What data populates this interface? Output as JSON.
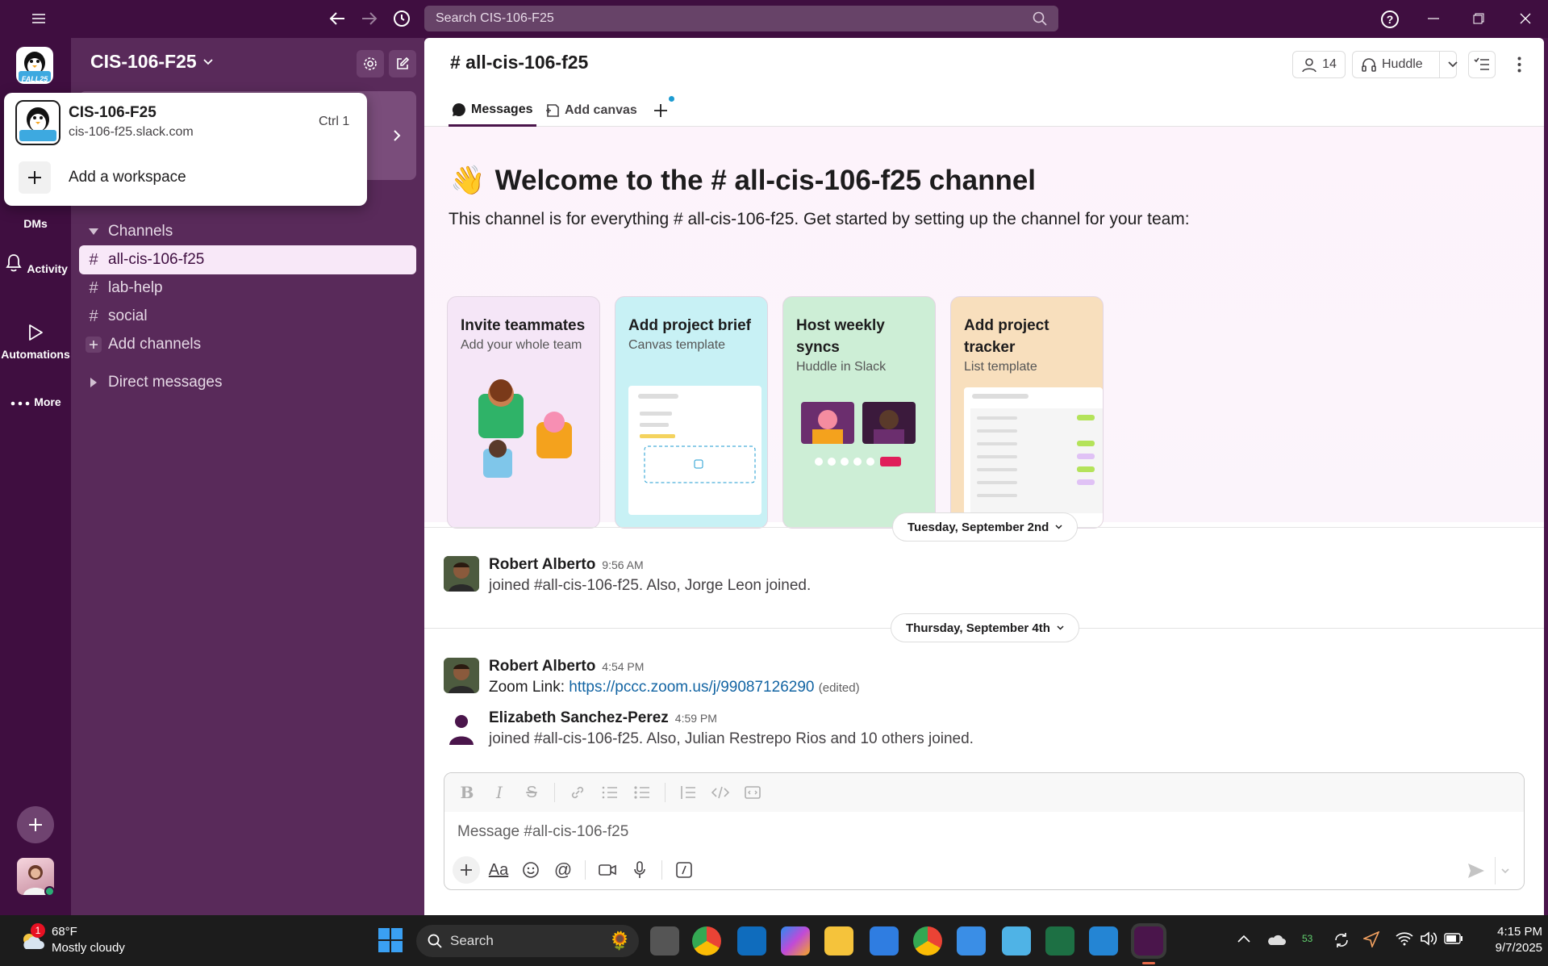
{
  "titlebar": {
    "search_placeholder": "Search CIS-106-F25"
  },
  "rail": {
    "items": [
      {
        "label": "DMs"
      },
      {
        "label": "Activity"
      },
      {
        "label": "Automations"
      },
      {
        "label": "More"
      }
    ],
    "workspace_logo_text": "FALL25"
  },
  "sidebar": {
    "workspace_name": "CIS-106-F25",
    "channels_header": "Channels",
    "channels": [
      {
        "name": "all-cis-106-f25",
        "active": true
      },
      {
        "name": "lab-help",
        "active": false
      },
      {
        "name": "social",
        "active": false
      }
    ],
    "add_channels": "Add channels",
    "direct_messages": "Direct messages"
  },
  "workspace_popup": {
    "name": "CIS-106-F25",
    "domain": "cis-106-f25.slack.com",
    "shortcut": "Ctrl 1",
    "add_label": "Add a workspace"
  },
  "channel": {
    "title": "# all-cis-106-f25",
    "member_count": "14",
    "huddle_label": "Huddle",
    "tabs": [
      {
        "label": "Messages",
        "active": true
      },
      {
        "label": "Add canvas",
        "active": false
      }
    ]
  },
  "welcome": {
    "emoji": "👋",
    "heading": "Welcome to the # all-cis-106-f25 channel",
    "description": "This channel is for everything # all-cis-106-f25. Get started by setting up the channel for your team:",
    "cards": [
      {
        "title": "Invite teammates",
        "subtitle": "Add your whole team",
        "color": "#f5e6f7"
      },
      {
        "title": "Add project brief",
        "subtitle": "Canvas template",
        "color": "#c8f1f5"
      },
      {
        "title": "Host weekly syncs",
        "subtitle": "Huddle in Slack",
        "color": "#cdeed6"
      },
      {
        "title": "Add project tracker",
        "subtitle": "List template",
        "color": "#f8dfbd"
      }
    ]
  },
  "messages": {
    "date1": "Tuesday, September 2nd",
    "date2": "Thursday, September 4th",
    "items": [
      {
        "author": "Robert Alberto",
        "time": "9:56 AM",
        "text": "joined #all-cis-106-f25. Also, Jorge Leon joined."
      },
      {
        "author": "Robert Alberto",
        "time": "4:54 PM",
        "text_prefix": "Zoom Link: ",
        "link": "https://pccc.zoom.us/j/99087126290",
        "edited": "(edited)"
      },
      {
        "author": "Elizabeth Sanchez-Perez",
        "time": "4:59 PM",
        "text": "joined #all-cis-106-f25. Also, Julian Restrepo Rios and 10 others joined."
      }
    ]
  },
  "composer": {
    "placeholder": "Message #all-cis-106-f25"
  },
  "taskbar": {
    "weather_temp": "68°F",
    "weather_desc": "Mostly cloudy",
    "weather_badge": "1",
    "search_label": "Search",
    "battery_badge": "53",
    "time": "4:15 PM",
    "date": "9/7/2025"
  },
  "colors": {
    "aubergine": "#3f0e40",
    "sidebar": "#592a5a",
    "link": "#1264a3",
    "active_channel": "#f8e8f8"
  }
}
